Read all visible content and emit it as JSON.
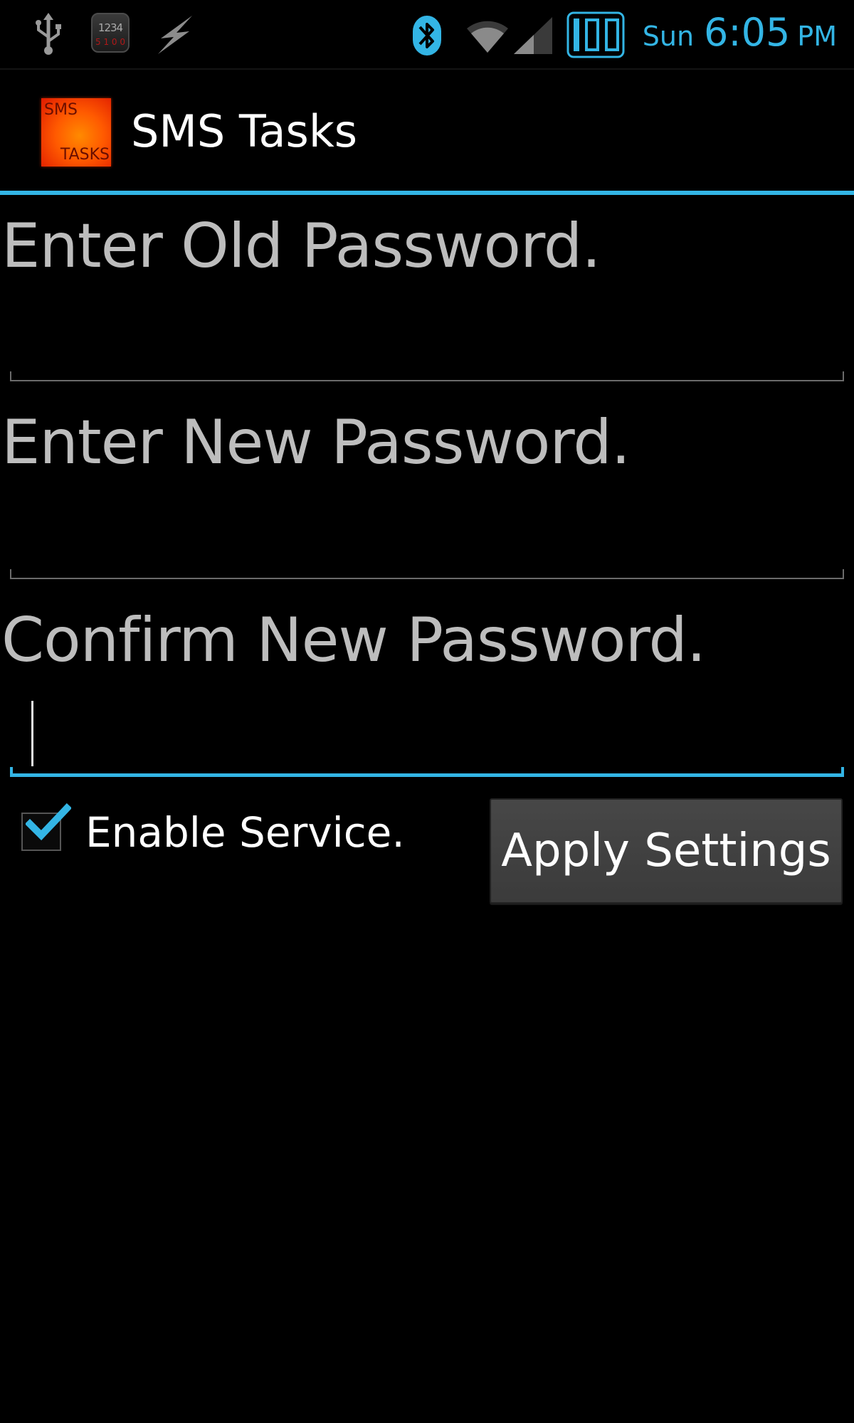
{
  "status_bar": {
    "notification_icons": [
      "usb-icon",
      "counter-app-icon",
      "lightning-icon"
    ],
    "counter_app": {
      "number": "1234",
      "sub_text": "5 1 0 0"
    },
    "system_icons": [
      "bluetooth-icon",
      "wifi-icon",
      "signal-icon",
      "battery-icon"
    ],
    "day": "Sun",
    "time": "6:05",
    "ampm": "PM",
    "accent_color": "#33b5e5"
  },
  "action_bar": {
    "logo_top_text": "SMS",
    "logo_bottom_text": "TASKS",
    "title": "SMS Tasks",
    "divider_color": "#33b5e5"
  },
  "form": {
    "old_password_label": "Enter Old Password.",
    "old_password_value": "",
    "new_password_label": "Enter New Password.",
    "new_password_value": "",
    "confirm_password_label": "Confirm New Password.",
    "confirm_password_value": "",
    "focused_field": "confirm_password"
  },
  "options": {
    "enable_service_label": "Enable Service.",
    "enable_service_checked": true,
    "apply_button_label": "Apply Settings"
  }
}
